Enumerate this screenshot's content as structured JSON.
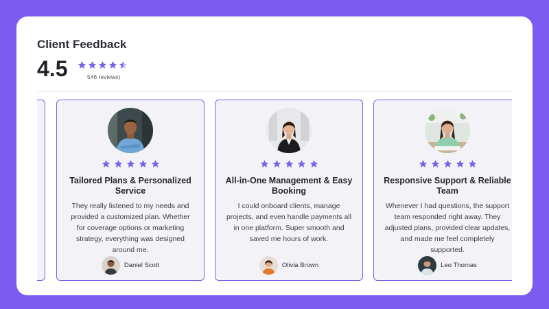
{
  "header": {
    "title": "Client Feedback",
    "score": "4.5",
    "reviews": "546 reviews)",
    "rating_value": 4.5,
    "rating_max": 5
  },
  "colors": {
    "background": "#7c5cf0",
    "star": "#7b62e6",
    "card_border": "#7b62e6",
    "card_bg": "#f2f2f7"
  },
  "cards": [
    {
      "title": "Tailored Plans & Personalized Service",
      "text": "They really listened to my needs and provided a customized plan. Whether for coverage options or marketing strategy, everything was designed around me.",
      "author": "Daniel Scott",
      "stars": 5
    },
    {
      "title": "All-in-One Management & Easy Booking",
      "text": "I could onboard clients, manage projects, and even handle payments all in one platform. Super smooth and saved me hours of work.",
      "author": "Olivia Brown",
      "stars": 5
    },
    {
      "title": "Responsive Support & Reliable Team",
      "text": "Whenever I had questions, the support team responded right away. They adjusted plans, provided clear updates, and made me feel completely supported.",
      "author": "Leo Thomas",
      "stars": 5
    }
  ]
}
